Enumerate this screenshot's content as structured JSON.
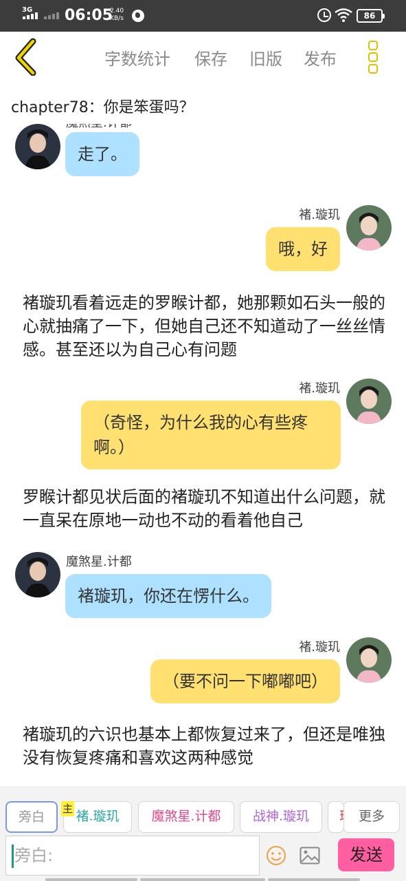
{
  "status_bar": {
    "network": "3G",
    "time": "06:05",
    "speed_value": "2.40",
    "speed_unit": "KB/s",
    "battery": "86"
  },
  "toolbar": {
    "back_icon": "chevron-left-icon",
    "items": [
      "字数统计",
      "保存",
      "旧版",
      "发布"
    ],
    "more_icon": "more-vertical-icon",
    "accent_color": "#e2c000"
  },
  "chapter": {
    "title": "chapter78：你是笨蛋吗？"
  },
  "chat": [
    {
      "kind": "message",
      "side": "left",
      "speaker": "魔煞星.计都",
      "text": "走了。",
      "color": "#aee0ff"
    },
    {
      "kind": "message",
      "side": "right",
      "speaker": "褚.璇玑",
      "text": "哦，好",
      "color": "#ffe070"
    },
    {
      "kind": "narration",
      "text": "褚璇玑看着远走的罗睺计都，她那颗如石头一般的心就抽痛了一下，但她自己还不知道动了一丝丝情感。甚至还以为自己心有问题"
    },
    {
      "kind": "message",
      "side": "right",
      "speaker": "褚.璇玑",
      "text": "（奇怪，为什么我的心有些疼啊。）",
      "color": "#ffe070"
    },
    {
      "kind": "narration",
      "text": "罗睺计都见状后面的褚璇玑不知道出什么问题，就一直呆在原地一动也不动的看着他自己"
    },
    {
      "kind": "message",
      "side": "left",
      "speaker": "魔煞星.计都",
      "text": "褚璇玑，你还在愣什么。",
      "color": "#aee0ff"
    },
    {
      "kind": "message",
      "side": "right",
      "speaker": "褚.璇玑",
      "text": "（要不问一下嘟嘟吧）",
      "color": "#ffe070"
    },
    {
      "kind": "narration",
      "text": "褚璇玑的六识也基本上都恢复过来了，但还是唯独没有恢复疼痛和喜欢这两种感觉"
    }
  ],
  "role_bar": {
    "chips": [
      {
        "label": "旁白",
        "color": "#999999",
        "active": true
      },
      {
        "label": "褚.璇玑",
        "color": "#2aa6a6",
        "main_badge": "主"
      },
      {
        "label": "魔煞星.计都",
        "color": "#e04a8c"
      },
      {
        "label": "战神.璇玑",
        "color": "#b065d8"
      },
      {
        "label": "琼",
        "color": "#e04a4a"
      }
    ],
    "more_label": "更多",
    "input_placeholder": "旁白:",
    "emoji_icon": "smiley-icon",
    "image_icon": "image-icon",
    "send_label": "发送",
    "send_color": "#ff5fa0"
  }
}
